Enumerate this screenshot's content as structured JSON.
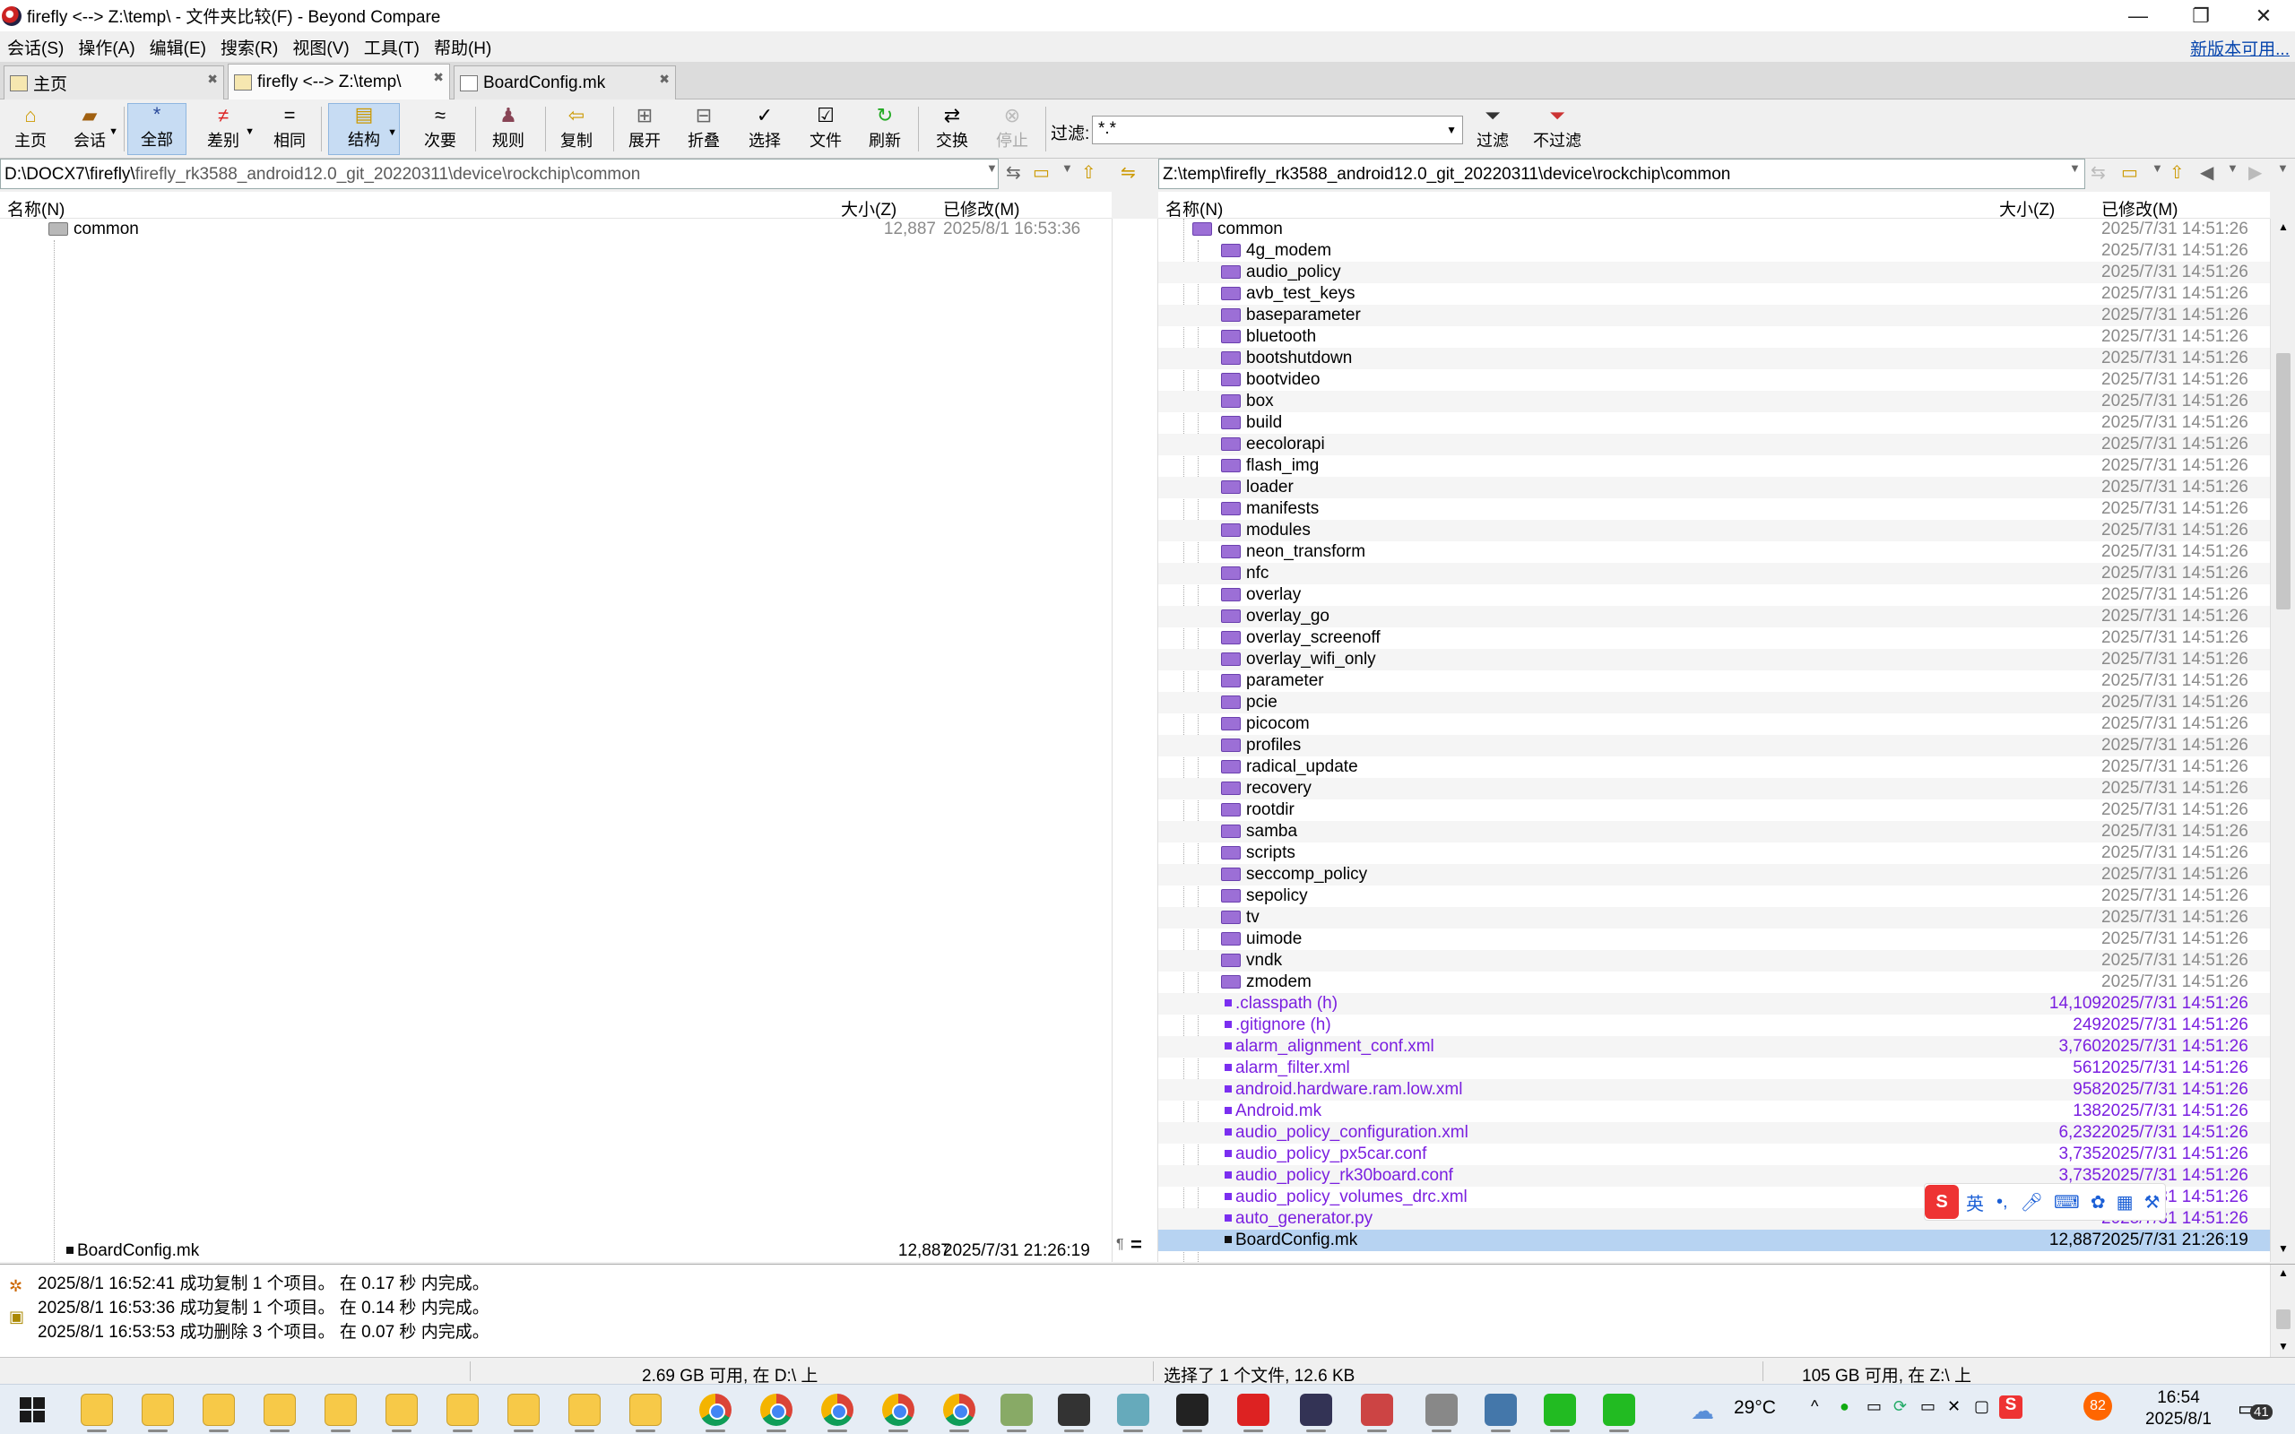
{
  "window": {
    "title": "firefly <--> Z:\\temp\\ - 文件夹比较(F) - Beyond Compare",
    "min": "—",
    "restore": "❐",
    "close": "✕"
  },
  "menu": [
    "会话(S)",
    "操作(A)",
    "编辑(E)",
    "搜索(R)",
    "视图(V)",
    "工具(T)",
    "帮助(H)"
  ],
  "new_version": "新版本可用...",
  "tabs": [
    {
      "label": "主页",
      "icon": "home-icon"
    },
    {
      "label": "firefly <--> Z:\\temp\\",
      "icon": "folder-compare-icon"
    },
    {
      "label": "BoardConfig.mk",
      "icon": "text-compare-icon"
    }
  ],
  "toolbar": {
    "home": "主页",
    "session": "会话",
    "all": "全部",
    "diffs": "差别",
    "same": "相同",
    "structure": "结构",
    "minor": "次要",
    "rules": "规则",
    "copy": "复制",
    "expand": "展开",
    "collapse": "折叠",
    "select": "选择",
    "files": "文件",
    "refresh": "刷新",
    "swap": "交换",
    "stop": "停止",
    "filter_label": "过滤:",
    "filter_value": "*.*",
    "filter": "过滤",
    "nofilter": "不过滤"
  },
  "left": {
    "path_prefix": "D:\\DOCX7\\firefly\\",
    "path_rest": "firefly_rk3588_android12.0_git_20220311\\device\\rockchip\\common",
    "headers": {
      "name": "名称(N)",
      "size": "大小(Z)",
      "modified": "已修改(M)"
    },
    "root": {
      "name": "common",
      "size": "12,887",
      "modified": "2025/8/1 16:53:36"
    },
    "selected": {
      "name": "BoardConfig.mk",
      "size": "12,887",
      "modified": "2025/7/31 21:26:19"
    }
  },
  "right": {
    "path": "Z:\\temp\\firefly_rk3588_android12.0_git_20220311\\device\\rockchip\\common",
    "headers": {
      "name": "名称(N)",
      "size": "大小(Z)",
      "modified": "已修改(M)"
    },
    "root": {
      "name": "common",
      "modified": "2025/7/31 14:51:26"
    },
    "folders": [
      "4g_modem",
      "audio_policy",
      "avb_test_keys",
      "baseparameter",
      "bluetooth",
      "bootshutdown",
      "bootvideo",
      "box",
      "build",
      "eecolorapi",
      "flash_img",
      "loader",
      "manifests",
      "modules",
      "neon_transform",
      "nfc",
      "overlay",
      "overlay_go",
      "overlay_screenoff",
      "overlay_wifi_only",
      "parameter",
      "pcie",
      "picocom",
      "profiles",
      "radical_update",
      "recovery",
      "rootdir",
      "samba",
      "scripts",
      "seccomp_policy",
      "sepolicy",
      "tv",
      "uimode",
      "vndk",
      "zmodem"
    ],
    "folder_date": "2025/7/31 14:51:26",
    "files": [
      {
        "name": ".classpath (h)",
        "size": "14,109",
        "modified": "2025/7/31 14:51:26"
      },
      {
        "name": ".gitignore (h)",
        "size": "249",
        "modified": "2025/7/31 14:51:26"
      },
      {
        "name": "alarm_alignment_conf.xml",
        "size": "3,760",
        "modified": "2025/7/31 14:51:26"
      },
      {
        "name": "alarm_filter.xml",
        "size": "561",
        "modified": "2025/7/31 14:51:26"
      },
      {
        "name": "android.hardware.ram.low.xml",
        "size": "958",
        "modified": "2025/7/31 14:51:26"
      },
      {
        "name": "Android.mk",
        "size": "138",
        "modified": "2025/7/31 14:51:26"
      },
      {
        "name": "audio_policy_configuration.xml",
        "size": "6,232",
        "modified": "2025/7/31 14:51:26"
      },
      {
        "name": "audio_policy_px5car.conf",
        "size": "3,735",
        "modified": "2025/7/31 14:51:26"
      },
      {
        "name": "audio_policy_rk30board.conf",
        "size": "3,735",
        "modified": "2025/7/31 14:51:26"
      },
      {
        "name": "audio_policy_volumes_drc.xml",
        "size": "",
        "modified": "2025/7/31 14:51:26"
      },
      {
        "name": "auto_generator.py",
        "size": "",
        "modified": "2025/7/31 14:51:26"
      }
    ],
    "selected": {
      "name": "BoardConfig.mk",
      "size": "12,887",
      "modified": "2025/7/31 21:26:19"
    }
  },
  "log": [
    "2025/8/1 16:52:41  成功复制 1 个项目。 在 0.17 秒 内完成。",
    "2025/8/1 16:53:36  成功复制 1 个项目。 在 0.14 秒 内完成。",
    "2025/8/1 16:53:53  成功删除 3 个项目。 在 0.07 秒 内完成。"
  ],
  "status": {
    "left": "2.69 GB 可用, 在 D:\\ 上",
    "mid": "选择了 1 个文件, 12.6 KB",
    "right": "105 GB 可用, 在 Z:\\ 上"
  },
  "ime": {
    "lang": "英",
    "punct": "•,"
  },
  "taskbar": {
    "weather": "29°C",
    "time": "16:54",
    "date": "2025/8/1",
    "notif": "41",
    "badge": "82"
  }
}
